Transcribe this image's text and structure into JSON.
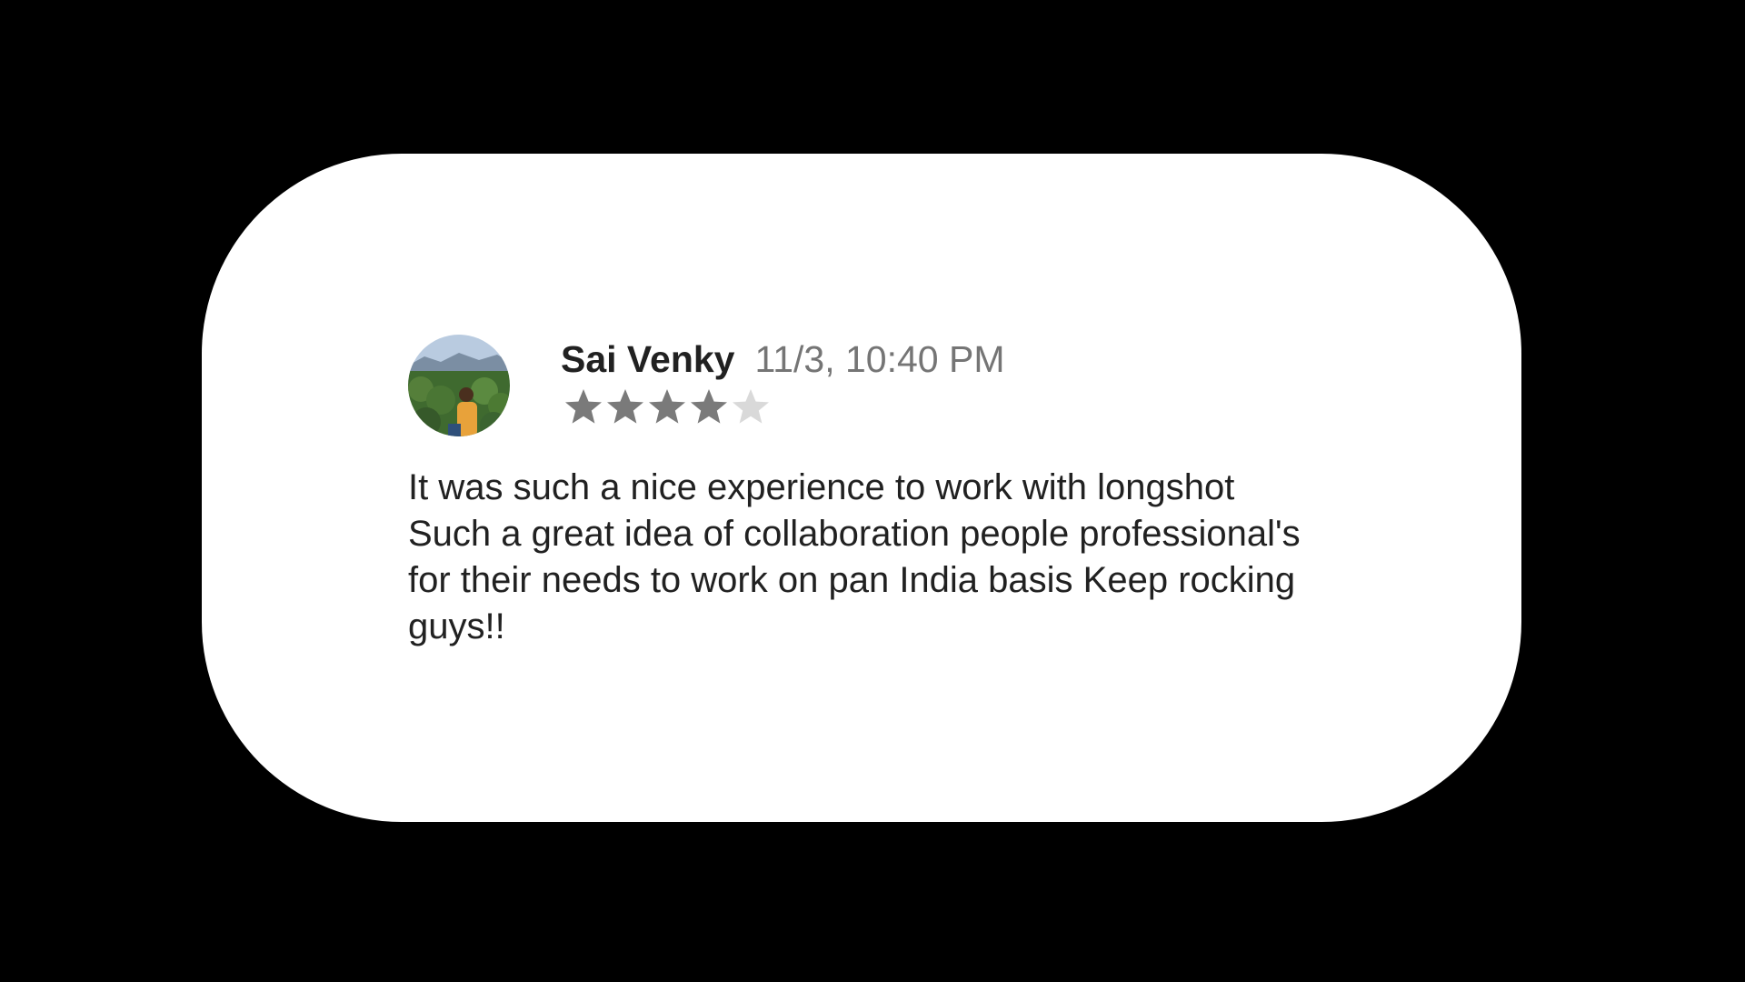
{
  "review": {
    "author": "Sai Venky",
    "date": "11/3, 10:40 PM",
    "rating": 4,
    "rating_max": 5,
    "text": "It was such a nice experience to work with longshot Such a great idea of collaboration people professional's for their needs to work on pan India basis Keep rocking guys!!",
    "avatar_icon": "profile-photo"
  },
  "colors": {
    "background": "#000000",
    "card": "#ffffff",
    "star_filled": "#7a7a7a",
    "star_empty": "#d9d9d9"
  }
}
